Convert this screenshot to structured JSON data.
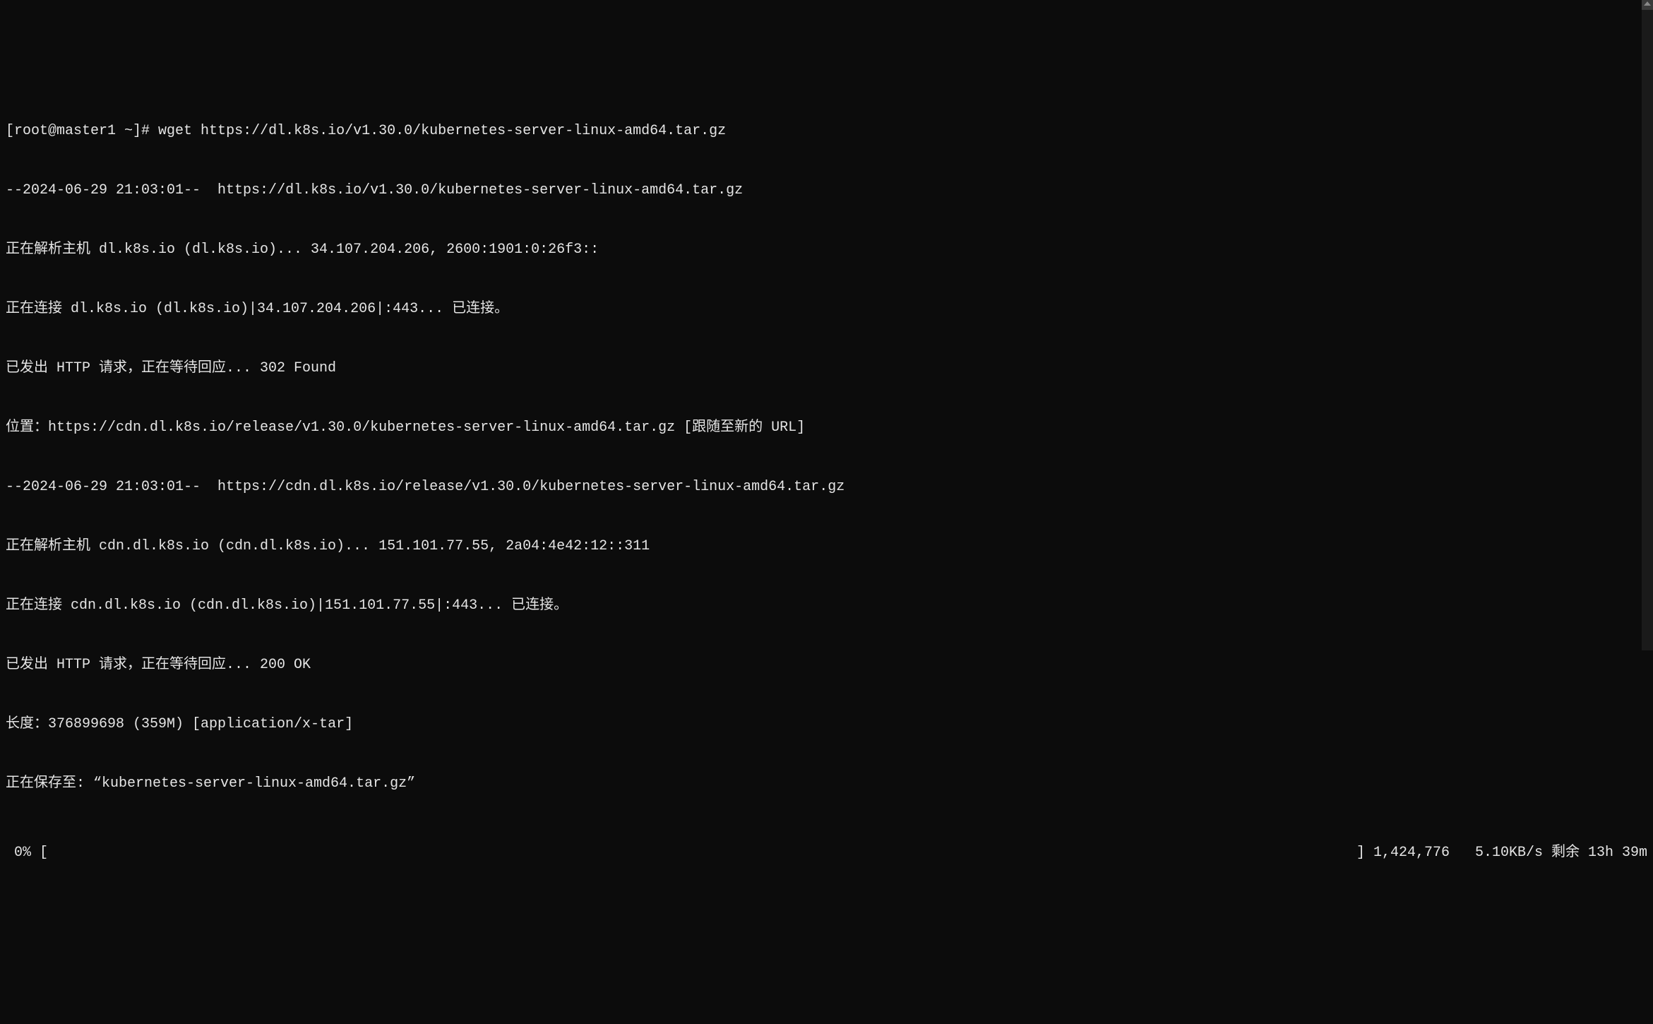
{
  "terminal": {
    "prompt": "[root@master1 ~]# ",
    "command": "wget https://dl.k8s.io/v1.30.0/kubernetes-server-linux-amd64.tar.gz",
    "lines": [
      "--2024-06-29 21:03:01--  https://dl.k8s.io/v1.30.0/kubernetes-server-linux-amd64.tar.gz",
      "正在解析主机 dl.k8s.io (dl.k8s.io)... 34.107.204.206, 2600:1901:0:26f3::",
      "正在连接 dl.k8s.io (dl.k8s.io)|34.107.204.206|:443... 已连接。",
      "已发出 HTTP 请求，正在等待回应... 302 Found",
      "位置：https://cdn.dl.k8s.io/release/v1.30.0/kubernetes-server-linux-amd64.tar.gz [跟随至新的 URL]",
      "--2024-06-29 21:03:01--  https://cdn.dl.k8s.io/release/v1.30.0/kubernetes-server-linux-amd64.tar.gz",
      "正在解析主机 cdn.dl.k8s.io (cdn.dl.k8s.io)... 151.101.77.55, 2a04:4e42:12::311",
      "正在连接 cdn.dl.k8s.io (cdn.dl.k8s.io)|151.101.77.55|:443... 已连接。",
      "已发出 HTTP 请求，正在等待回应... 200 OK",
      "长度：376899698 (359M) [application/x-tar]",
      "正在保存至: “kubernetes-server-linux-amd64.tar.gz”"
    ],
    "progress": {
      "percent": " 0% [",
      "stats": "] 1,424,776   5.10KB/s 剩余 13h 39m"
    }
  }
}
